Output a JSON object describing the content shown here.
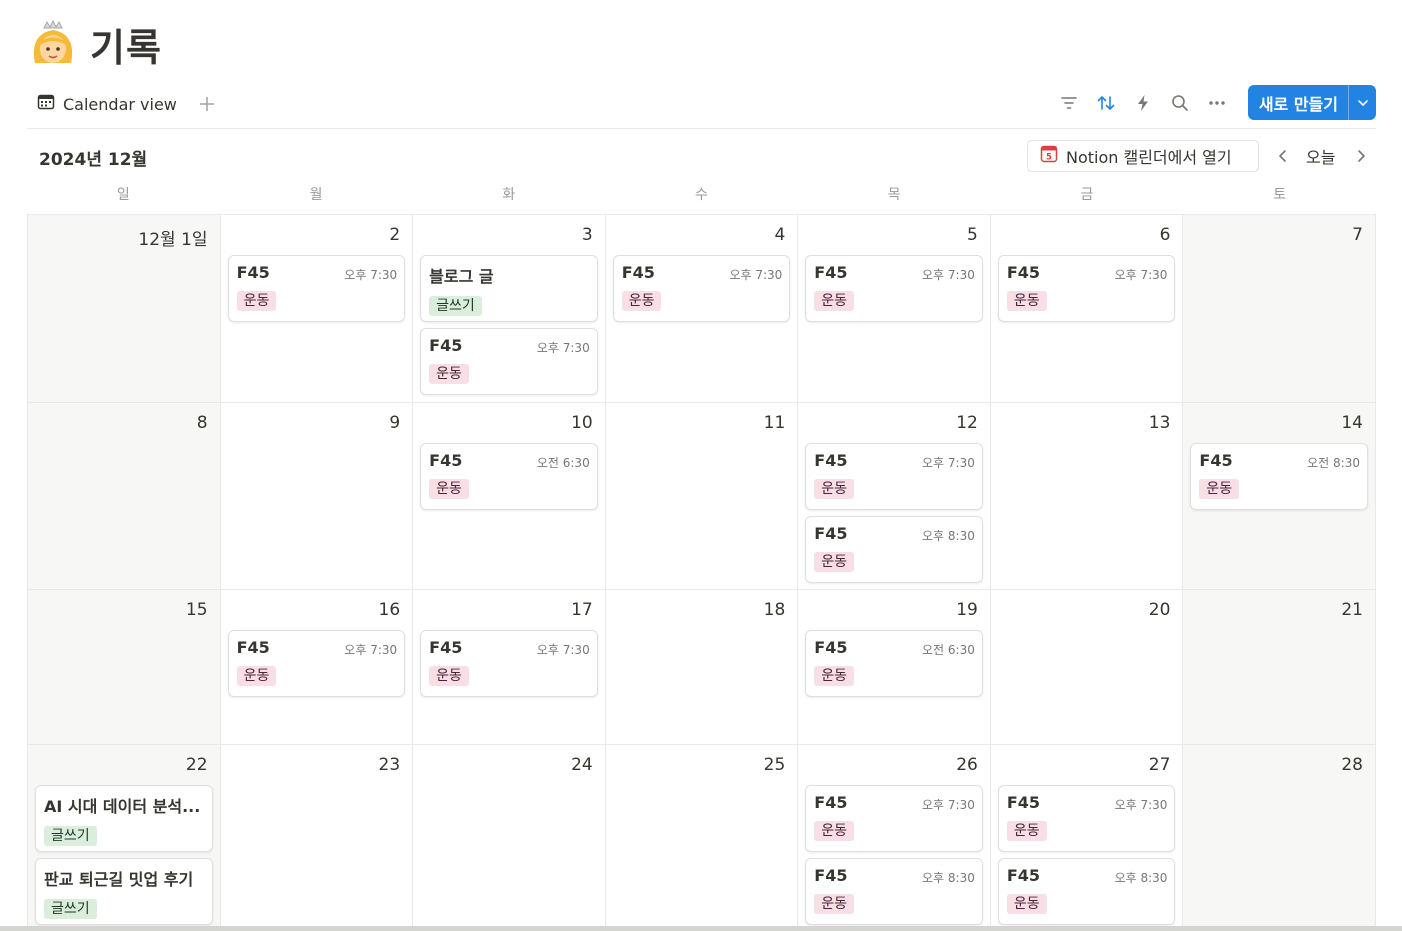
{
  "page": {
    "title": "기록",
    "emoji_icon": "person-emoji-icon"
  },
  "view_bar": {
    "tab_label": "Calendar view",
    "new_button_label": "새로 만들기",
    "accent_color": "#2383e2"
  },
  "calendar": {
    "month_label": "2024년 12월",
    "open_in_calendar_label": "Notion 캘린더에서 열기",
    "calendar_icon_digit": "5",
    "today_label": "오늘",
    "weekdays": [
      "일",
      "월",
      "화",
      "수",
      "목",
      "금",
      "토"
    ],
    "tag_colors": {
      "운동": "#f8dfe6",
      "글쓰기": "#dbeddb"
    },
    "weeks": [
      [
        {
          "label": "12월 1일",
          "weekend": true,
          "events": []
        },
        {
          "label": "2",
          "events": [
            {
              "title": "F45",
              "time": "오후 7:30",
              "tag": "운동"
            }
          ]
        },
        {
          "label": "3",
          "events": [
            {
              "title": "블로그 글",
              "time": "",
              "tag": "글쓰기"
            },
            {
              "title": "F45",
              "time": "오후 7:30",
              "tag": "운동"
            }
          ]
        },
        {
          "label": "4",
          "events": [
            {
              "title": "F45",
              "time": "오후 7:30",
              "tag": "운동"
            }
          ]
        },
        {
          "label": "5",
          "events": [
            {
              "title": "F45",
              "time": "오후 7:30",
              "tag": "운동"
            }
          ]
        },
        {
          "label": "6",
          "events": [
            {
              "title": "F45",
              "time": "오후 7:30",
              "tag": "운동"
            }
          ]
        },
        {
          "label": "7",
          "weekend": true,
          "events": []
        }
      ],
      [
        {
          "label": "8",
          "weekend": true,
          "events": []
        },
        {
          "label": "9",
          "events": []
        },
        {
          "label": "10",
          "events": [
            {
              "title": "F45",
              "time": "오전 6:30",
              "tag": "운동"
            }
          ]
        },
        {
          "label": "11",
          "events": []
        },
        {
          "label": "12",
          "events": [
            {
              "title": "F45",
              "time": "오후 7:30",
              "tag": "운동"
            },
            {
              "title": "F45",
              "time": "오후 8:30",
              "tag": "운동"
            }
          ]
        },
        {
          "label": "13",
          "events": []
        },
        {
          "label": "14",
          "weekend": true,
          "events": [
            {
              "title": "F45",
              "time": "오전 8:30",
              "tag": "운동"
            }
          ]
        }
      ],
      [
        {
          "label": "15",
          "weekend": true,
          "events": []
        },
        {
          "label": "16",
          "events": [
            {
              "title": "F45",
              "time": "오후 7:30",
              "tag": "운동"
            }
          ]
        },
        {
          "label": "17",
          "events": [
            {
              "title": "F45",
              "time": "오후 7:30",
              "tag": "운동"
            }
          ]
        },
        {
          "label": "18",
          "events": []
        },
        {
          "label": "19",
          "events": [
            {
              "title": "F45",
              "time": "오전 6:30",
              "tag": "운동"
            }
          ]
        },
        {
          "label": "20",
          "events": []
        },
        {
          "label": "21",
          "weekend": true,
          "events": []
        }
      ],
      [
        {
          "label": "22",
          "weekend": true,
          "events": [
            {
              "title": "AI 시대 데이터 분석...",
              "time": "",
              "tag": "글쓰기"
            },
            {
              "title": "판교 퇴근길 밋업 후기",
              "time": "",
              "tag": "글쓰기"
            }
          ]
        },
        {
          "label": "23",
          "events": []
        },
        {
          "label": "24",
          "events": []
        },
        {
          "label": "25",
          "events": []
        },
        {
          "label": "26",
          "events": [
            {
              "title": "F45",
              "time": "오후 7:30",
              "tag": "운동"
            },
            {
              "title": "F45",
              "time": "오후 8:30",
              "tag": "운동"
            }
          ]
        },
        {
          "label": "27",
          "events": [
            {
              "title": "F45",
              "time": "오후 7:30",
              "tag": "운동"
            },
            {
              "title": "F45",
              "time": "오후 8:30",
              "tag": "운동"
            }
          ]
        },
        {
          "label": "28",
          "weekend": true,
          "events": []
        }
      ]
    ]
  }
}
